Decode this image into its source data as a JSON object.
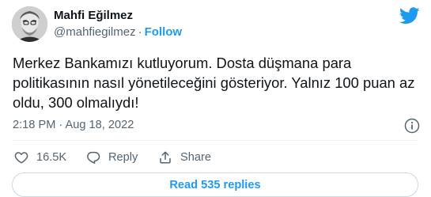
{
  "author": {
    "name": "Mahfi Eğilmez",
    "handle": "@mahfiegilmez",
    "separator": "·",
    "follow_label": "Follow"
  },
  "tweet": {
    "text": "Merkez Bankamızı kutluyorum. Dosta düşmana para politikasının nasıl yönetileceğini gösteriyor. Yalnız 100 puan az oldu, 300 olmalıydı!",
    "timestamp": "2:18 PM · Aug 18, 2022"
  },
  "actions": {
    "like_count": "16.5K",
    "reply_label": "Reply",
    "share_label": "Share"
  },
  "read_replies_label": "Read 535 replies",
  "icons": {
    "brand": "twitter-bird-icon",
    "info": "info-icon",
    "like": "heart-icon",
    "reply": "reply-bubble-icon",
    "share": "share-icon"
  },
  "colors": {
    "accent": "#1d9bf0",
    "secondary_text": "#536471",
    "primary_text": "#0f1419",
    "border": "#cfd9de"
  }
}
